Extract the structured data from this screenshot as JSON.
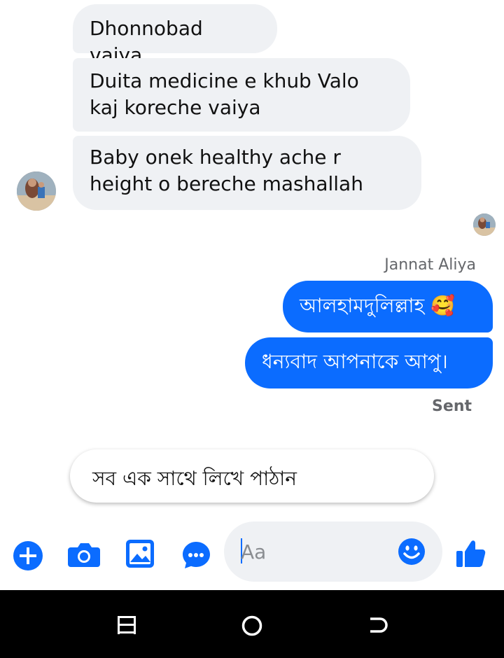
{
  "conversation": {
    "incoming": [
      {
        "text": "Dhonnobad vaiya"
      },
      {
        "text": "Duita medicine e khub Valo kaj koreche vaiya"
      },
      {
        "text": "Baby onek healthy ache r height o bereche mashallah"
      }
    ],
    "sender_name": "Jannat Aliya",
    "outgoing": [
      {
        "text": "আলহামদুলিল্লাহ 🥰"
      },
      {
        "text": "ধন্যবাদ আপনাকে আপু।"
      }
    ],
    "status": "Sent"
  },
  "suggestion": {
    "text": "সব এক সাথে লিখে পাঠান"
  },
  "composer": {
    "placeholder": "Aa"
  },
  "icons": {
    "add": "plus-icon",
    "camera": "camera-icon",
    "gallery": "image-icon",
    "chat": "chat-bubble-icon",
    "emoji": "emoji-icon",
    "like": "thumbs-up-icon",
    "nav_menu": "menu-icon",
    "nav_home": "home-icon",
    "nav_back": "back-icon"
  },
  "colors": {
    "accent": "#0b6cff",
    "incoming_bubble": "#eff1f4",
    "nav_bar": "#000000"
  }
}
